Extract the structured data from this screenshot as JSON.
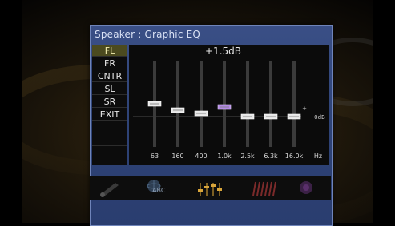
{
  "panel": {
    "title": "Speaker : Graphic EQ"
  },
  "channels": [
    {
      "label": "FL",
      "selected": true
    },
    {
      "label": "FR",
      "selected": false
    },
    {
      "label": "CNTR",
      "selected": false
    },
    {
      "label": "SL",
      "selected": false
    },
    {
      "label": "SR",
      "selected": false
    },
    {
      "label": "EXIT",
      "selected": false
    },
    {
      "label": "",
      "selected": false
    },
    {
      "label": "",
      "selected": false
    }
  ],
  "eq": {
    "gain_readout": "+1.5dB",
    "unit_label": "Hz",
    "plus_label": "+",
    "minus_label": "–",
    "zero_label": "0dB",
    "active_band": "1.0k",
    "bands": [
      {
        "freq": "63",
        "gain_db": 2.0
      },
      {
        "freq": "160",
        "gain_db": 1.0
      },
      {
        "freq": "400",
        "gain_db": 0.5
      },
      {
        "freq": "1.0k",
        "gain_db": 1.5
      },
      {
        "freq": "2.5k",
        "gain_db": 0.0
      },
      {
        "freq": "6.3k",
        "gain_db": 0.0
      },
      {
        "freq": "16.0k",
        "gain_db": 0.0
      }
    ]
  },
  "bottom_menu": {
    "abc_label": "ABC",
    "icons": [
      "speaker-icon",
      "globe-abc-icon",
      "graphic-eq-icon",
      "level-bars-icon",
      "purple-settings-icon"
    ]
  },
  "colors": {
    "panel_blue": "#2f4478",
    "selected_row": "#4b4a1f",
    "active_knob": "#b48be6"
  }
}
